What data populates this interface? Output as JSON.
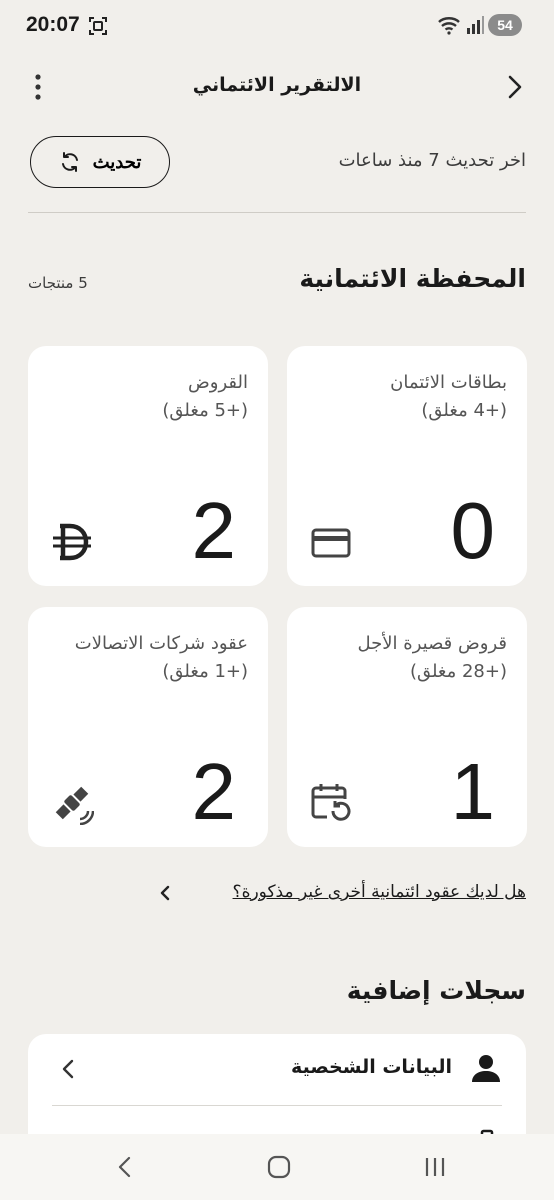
{
  "status_bar": {
    "time": "20:07",
    "battery": "54"
  },
  "header": {
    "title": "الالتقرير الائتماني"
  },
  "refresh": {
    "button_label": "تحديث",
    "last_updated": "اخر تحديث 7 منذ ساعات"
  },
  "portfolio": {
    "title": "المحفظة الائتمانية",
    "products_count": "5 منتجات",
    "cards": [
      {
        "title": "بطاقات الائتمان",
        "closed": "(+4 مغلق)",
        "count": "0",
        "icon": "credit-card-icon"
      },
      {
        "title": "القروض",
        "closed": "(+5 مغلق)",
        "count": "2",
        "icon": "dirham-icon"
      },
      {
        "title": "قروض قصيرة الأجل",
        "closed": "(+28 مغلق)",
        "count": "1",
        "icon": "calendar-return-icon"
      },
      {
        "title": "عقود شركات الاتصالات",
        "closed": "(+1 مغلق)",
        "count": "2",
        "icon": "satellite-icon"
      }
    ]
  },
  "more_contracts": {
    "label": "هل لديك عقود ائتمانية أخرى غير مذكورة؟"
  },
  "records": {
    "title": "سجلات إضافية",
    "items": [
      {
        "label": "البيانات الشخصية",
        "icon": "person-icon"
      },
      {
        "label": "",
        "icon": "briefcase-icon"
      }
    ]
  },
  "colors": {
    "background": "#f1efeb",
    "card": "#ffffff",
    "text": "#1a1a1a",
    "muted": "#555555"
  }
}
